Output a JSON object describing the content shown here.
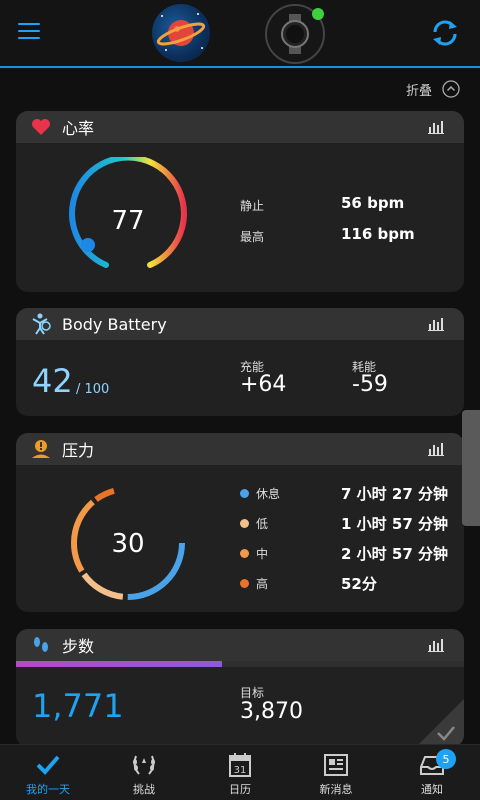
{
  "header": {
    "collapse_label": "折叠"
  },
  "heart_rate": {
    "title": "心率",
    "current": "77",
    "resting_label": "静止",
    "resting_value": "56 bpm",
    "max_label": "最高",
    "max_value": "116 bpm",
    "fill_fraction": 0.74,
    "color": "#e8344a"
  },
  "body_battery": {
    "title": "Body Battery",
    "value": "42",
    "max": "/ 100",
    "charged_label": "充能",
    "charged_value": "+64",
    "drained_label": "耗能",
    "drained_value": "-59",
    "accent": "#8fd3ff"
  },
  "stress": {
    "title": "压力",
    "level": "30",
    "rows": [
      {
        "label": "休息",
        "value": "7 小时 27 分钟",
        "color": "#4aa3e8"
      },
      {
        "label": "低",
        "value": "1 小时 57 分钟",
        "color": "#f4c08a"
      },
      {
        "label": "中",
        "value": "2 小时 57 分钟",
        "color": "#f09a4a"
      },
      {
        "label": "高",
        "value": "52分",
        "color": "#e8742a"
      }
    ]
  },
  "steps": {
    "title": "步数",
    "value": "1,771",
    "goal_label": "目标",
    "goal_value": "3,870",
    "progress_fraction": 0.46,
    "accent": "#1fa2f2"
  },
  "nav": [
    {
      "label": "我的一天",
      "icon": "check-icon",
      "active": true
    },
    {
      "label": "挑战",
      "icon": "laurel-icon",
      "active": false
    },
    {
      "label": "日历",
      "icon": "calendar-icon",
      "active": false,
      "calendar_day": "31"
    },
    {
      "label": "新消息",
      "icon": "news-icon",
      "active": false
    },
    {
      "label": "通知",
      "icon": "inbox-icon",
      "active": false,
      "badge": "5"
    }
  ]
}
